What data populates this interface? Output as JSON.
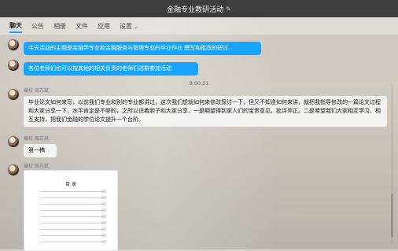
{
  "window": {
    "title": "金融专业教研活动",
    "title_edit_icon": "edit-icon"
  },
  "tabs": [
    {
      "label": "聊天",
      "active": true
    },
    {
      "label": "公告",
      "active": false
    },
    {
      "label": "相册",
      "active": false
    },
    {
      "label": "文件",
      "active": false
    },
    {
      "label": "应用",
      "active": false
    },
    {
      "label": "设置",
      "active": false,
      "has_dropdown": true
    }
  ],
  "chat": {
    "messages": [
      {
        "type": "blue",
        "text": "今天活动的主题是金融学专业和金融服务与管理专业的毕业作业 撰写和批改的研讨"
      },
      {
        "type": "blue",
        "text": "各位老师们也可以按其他的相关负责的老师们进群参加活动"
      },
      {
        "type": "timestamp",
        "text": "9:00:31"
      },
      {
        "type": "gray",
        "sender": "编校 周志斌",
        "text": "毕业论文如何来写，以前我们专业和别的专业都讲过，这次我们想就如何来修改探讨一下，但又不知道如何来讲，就把我指导修改的一篇论文过程和大家分享一下，水平肯定是不够的，之所以往着胆子和大家分享，一是期望得到家人们的宝贵意见，批评斧正。二是希望我们大家相互学习、相互支持，把我们金融的学位论文提升一个台阶。"
      },
      {
        "type": "gray",
        "sender": "编校 周志斌",
        "text": "第一稿"
      },
      {
        "type": "doc",
        "sender": "编校 周志斌",
        "doc_title": "目 录"
      }
    ]
  },
  "colors": {
    "titlebar_bg": "#3d3d3d",
    "accent_blue": "#16a4ff"
  }
}
